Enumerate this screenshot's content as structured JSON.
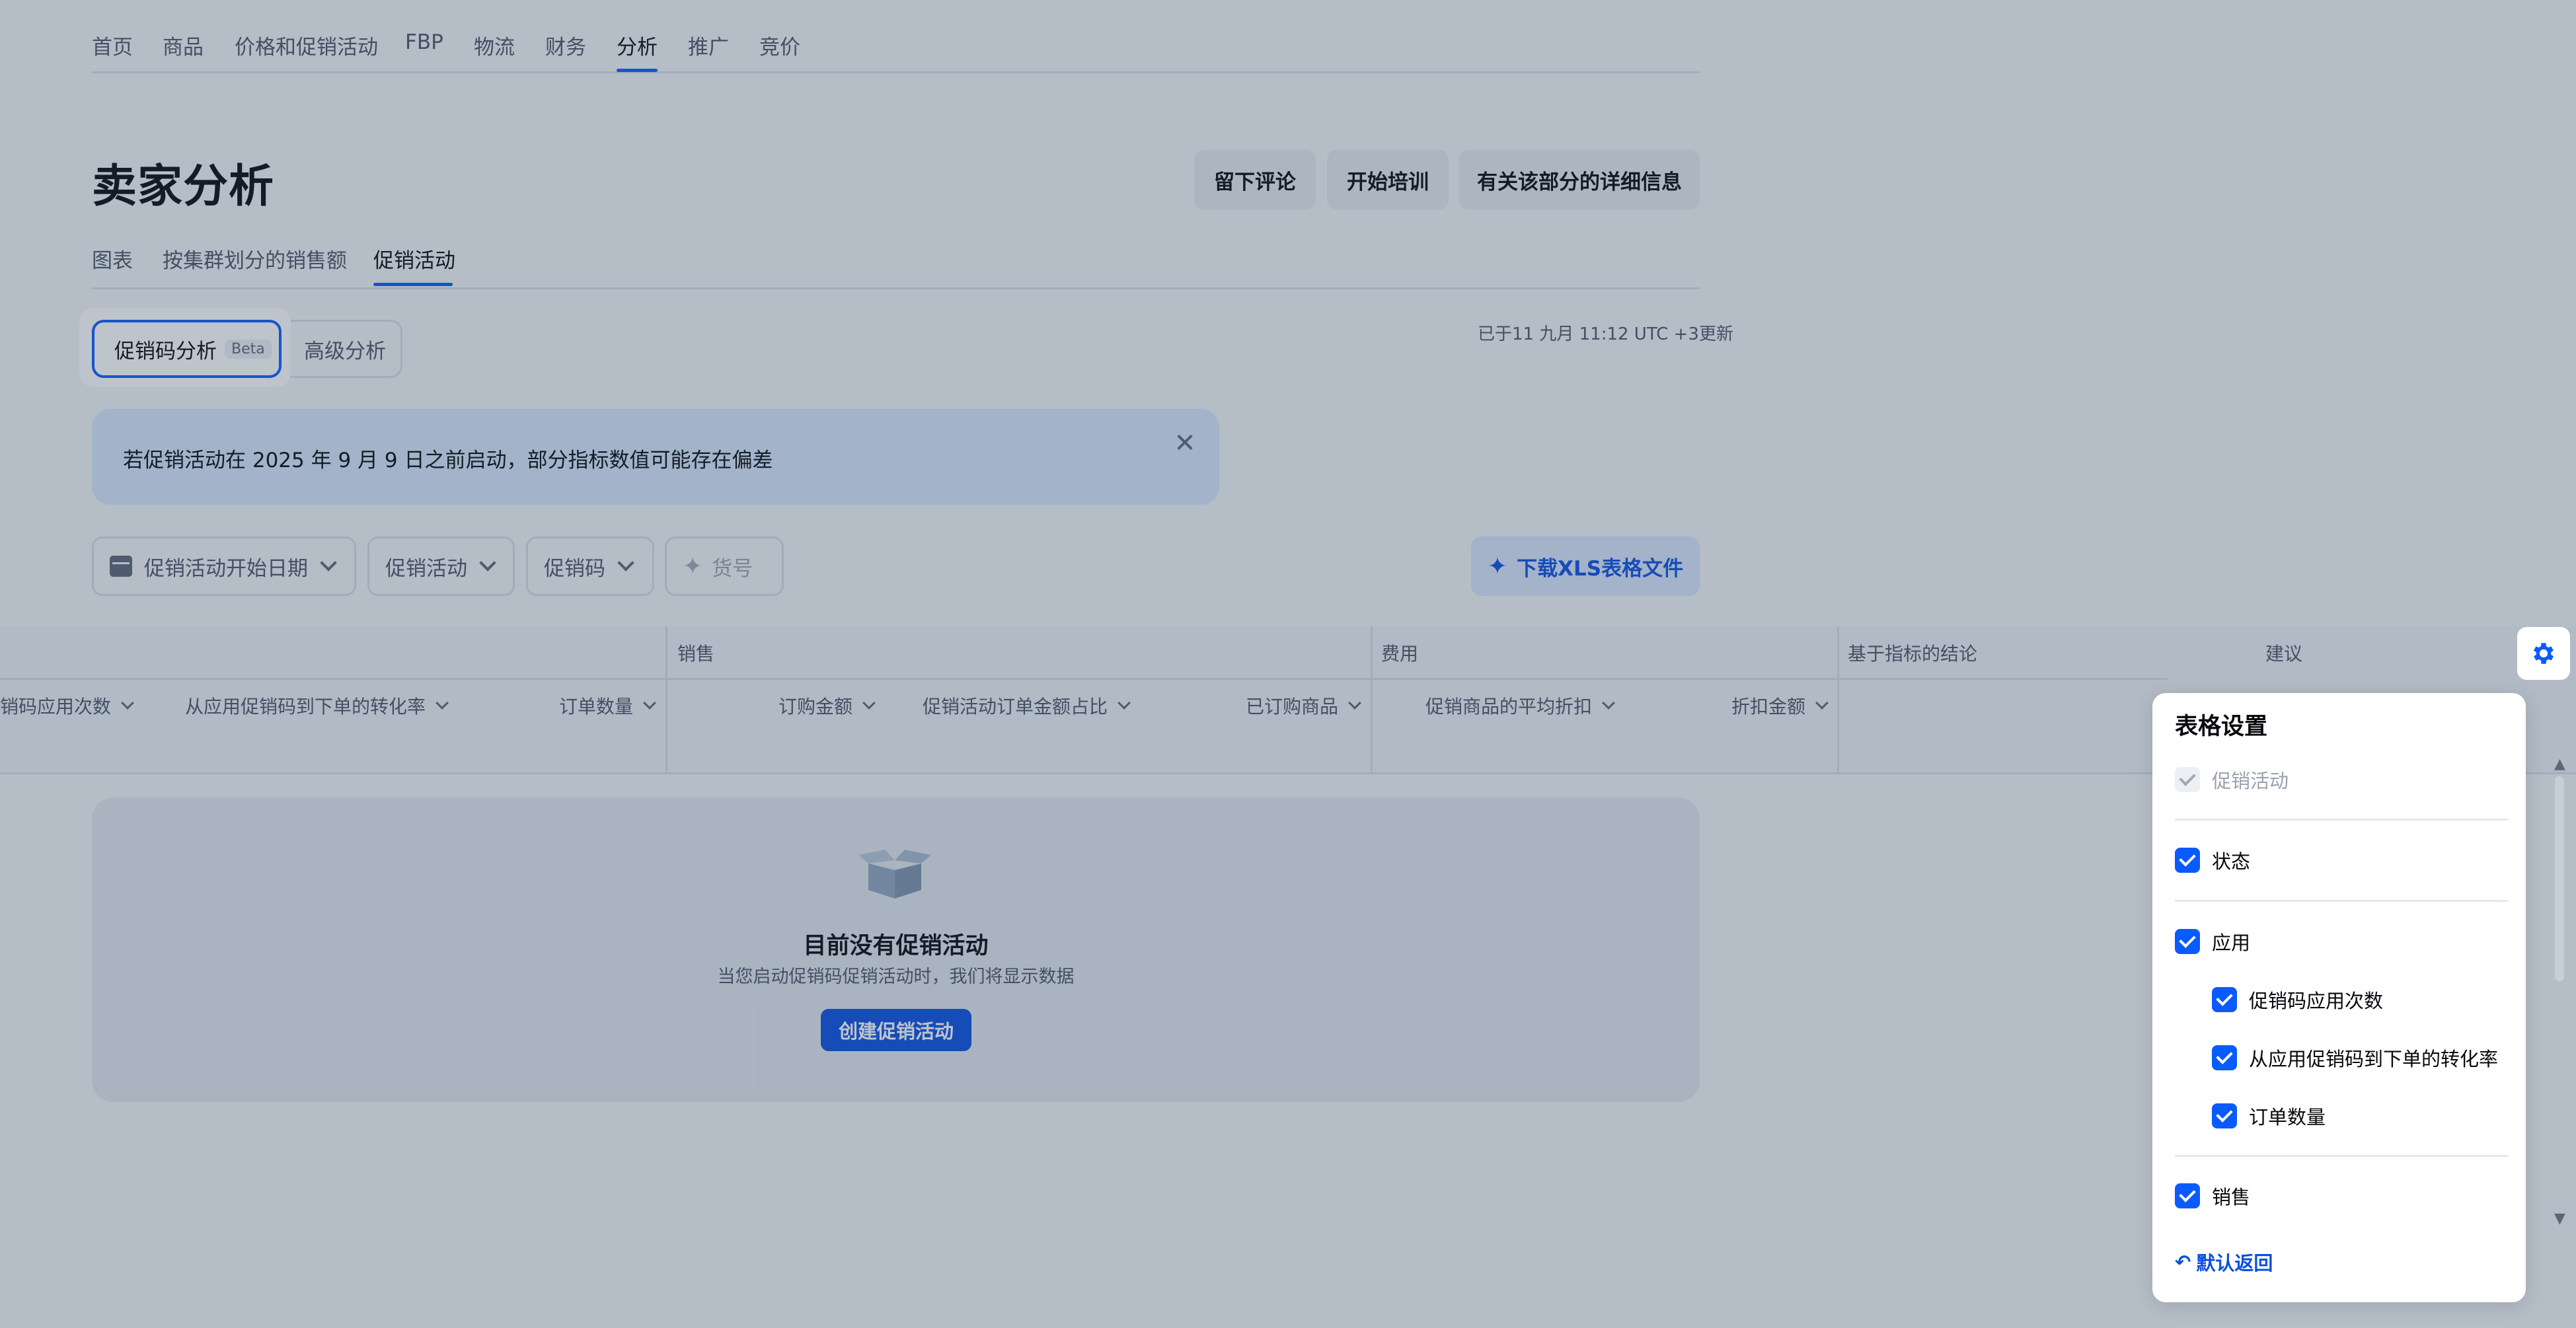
{
  "nav": {
    "items": [
      "首页",
      "商品",
      "价格和促销活动",
      "FBP",
      "物流",
      "财务",
      "分析",
      "推广",
      "竞价"
    ],
    "active_index": 6
  },
  "page": {
    "title": "卖家分析"
  },
  "header_buttons": {
    "review": "留下评论",
    "training": "开始培训",
    "details": "有关该部分的详细信息"
  },
  "subtabs": {
    "items": [
      "图表",
      "按集群划分的销售额",
      "促销活动"
    ],
    "active_index": 2
  },
  "segments": {
    "promo_code_analysis": "促销码分析",
    "beta": "Beta",
    "advanced": "高级分析"
  },
  "updated_text": "已于11 九月 11:12 UTC +3更新",
  "banner": {
    "text": "若促销活动在 2025 年 9 月 9 日之前启动，部分指标数值可能存在偏差"
  },
  "filters": {
    "start_date": "促销活动开始日期",
    "promotion": "促销活动",
    "promo_code": "促销码",
    "sku": "货号"
  },
  "download_xls": "下载XLS表格文件",
  "table": {
    "groups": {
      "sales": "销售",
      "costs": "费用",
      "conclusions": "基于指标的结论",
      "recommendations": "建议"
    },
    "columns": {
      "applications": "销码应用次数",
      "conversion": "从应用促销码到下单的转化率",
      "orders": "订单数量",
      "order_amount": "订购金额",
      "share": "促销活动订单金额占比",
      "ordered_goods": "已订购商品",
      "avg_discount": "促销商品的平均折扣",
      "discount_amount": "折扣金额"
    }
  },
  "empty_state": {
    "title": "目前没有促销活动",
    "subtitle": "当您启动促销码促销活动时，我们将显示数据",
    "create_button": "创建促销活动"
  },
  "settings_panel": {
    "title": "表格设置",
    "options": {
      "promotion": "促销活动",
      "status": "状态",
      "application": "应用",
      "code_applications": "促销码应用次数",
      "conversion": "从应用促销码到下单的转化率",
      "order_count": "订单数量",
      "sales": "销售"
    },
    "reset": "默认返回"
  },
  "colors": {
    "accent": "#0a5bff",
    "banner_bg": "#d9e6fb",
    "dim_overlay": "#32465f"
  }
}
